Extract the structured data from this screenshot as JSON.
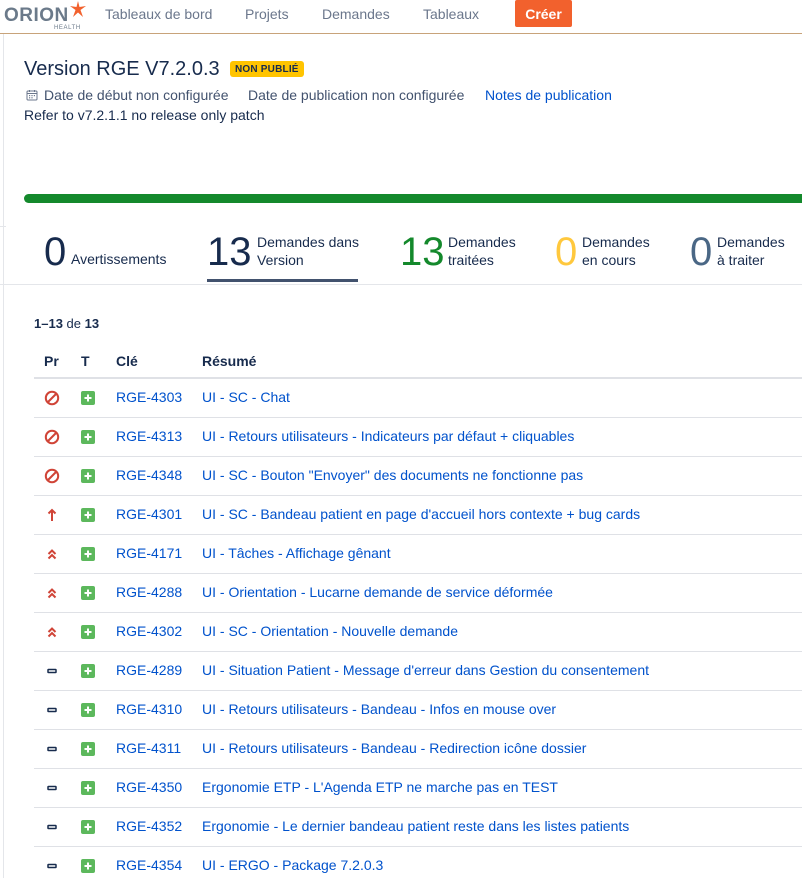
{
  "nav": {
    "logo_word": "ORION",
    "logo_sub": "HEALTH",
    "links": [
      "Tableaux de bord",
      "Projets",
      "Demandes",
      "Tableaux"
    ],
    "create_label": "Créer",
    "accent": "#f2612d"
  },
  "version": {
    "title": "Version RGE V7.2.0.3",
    "status_badge": "NON PUBLIÉ",
    "start_date": "Date de début non configurée",
    "release_date": "Date de publication non configurée",
    "release_notes": "Notes de publication",
    "description": "Refer to v7.2.1.1 no release only patch",
    "progress_done_fraction": 1.0
  },
  "stats": [
    {
      "num": "0",
      "label": "Avertissements",
      "color": "#172b4d"
    },
    {
      "num": "13",
      "label1": "Demandes dans",
      "label2": "Version",
      "color": "#172b4d"
    },
    {
      "num": "13",
      "label1": "Demandes",
      "label2": "traitées",
      "color": "#14892c"
    },
    {
      "num": "0",
      "label1": "Demandes",
      "label2": "en cours",
      "color": "#ffc83d"
    },
    {
      "num": "0",
      "label1": "Demandes",
      "label2": "à traiter",
      "color": "#4a6785"
    }
  ],
  "list": {
    "range": "1–13",
    "of_word": "de",
    "total": "13",
    "headers": {
      "priority": "Pr",
      "type": "T",
      "key": "Clé",
      "summary": "Résumé"
    },
    "rows": [
      {
        "priority": "blocker",
        "key": "RGE-4303",
        "summary": "UI - SC - Chat"
      },
      {
        "priority": "blocker",
        "key": "RGE-4313",
        "summary": "UI - Retours utilisateurs - Indicateurs par défaut + cliquables"
      },
      {
        "priority": "blocker",
        "key": "RGE-4348",
        "summary": "UI - SC - Bouton \"Envoyer\" des documents ne fonctionne pas"
      },
      {
        "priority": "high",
        "key": "RGE-4301",
        "summary": "UI - SC - Bandeau patient en page d'accueil hors contexte + bug cards"
      },
      {
        "priority": "highest",
        "key": "RGE-4171",
        "summary": "UI - Tâches - Affichage gênant"
      },
      {
        "priority": "highest",
        "key": "RGE-4288",
        "summary": "UI - Orientation - Lucarne demande de service déformée"
      },
      {
        "priority": "highest",
        "key": "RGE-4302",
        "summary": "UI - SC - Orientation - Nouvelle demande"
      },
      {
        "priority": "medium",
        "key": "RGE-4289",
        "summary": "UI - Situation Patient - Message d'erreur dans Gestion du consentement"
      },
      {
        "priority": "medium",
        "key": "RGE-4310",
        "summary": "UI - Retours utilisateurs - Bandeau - Infos en mouse over"
      },
      {
        "priority": "medium",
        "key": "RGE-4311",
        "summary": "UI - Retours utilisateurs - Bandeau - Redirection icône dossier"
      },
      {
        "priority": "medium",
        "key": "RGE-4350",
        "summary": "Ergonomie ETP - L'Agenda ETP ne marche pas en TEST"
      },
      {
        "priority": "medium",
        "key": "RGE-4352",
        "summary": "Ergonomie - Le dernier bandeau patient reste dans les listes patients"
      },
      {
        "priority": "medium",
        "key": "RGE-4354",
        "summary": "UI - ERGO - Package 7.2.0.3"
      }
    ],
    "type_icon": "improvement-icon",
    "type_color": "#5cb85c",
    "priority_colors": {
      "blocker": "#d04437",
      "high": "#d04437",
      "highest": "#d04437",
      "medium": "#172b4d"
    }
  }
}
